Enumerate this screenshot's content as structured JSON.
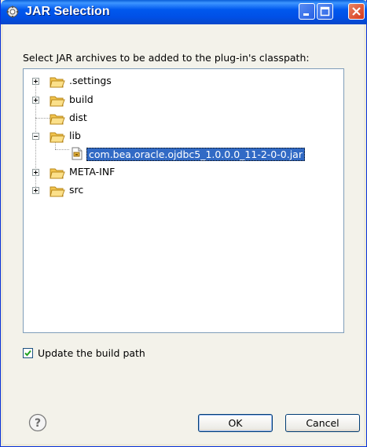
{
  "window": {
    "title": "JAR Selection",
    "icon": "gear-icon",
    "controls": [
      "minimize-icon",
      "maximize-icon",
      "close-icon"
    ]
  },
  "instructions": "Select JAR archives to be added to the plug-in's classpath:",
  "tree": {
    "nodes": [
      {
        "label": ".settings",
        "expandable": true,
        "expanded": false
      },
      {
        "label": "build",
        "expandable": true,
        "expanded": false
      },
      {
        "label": "dist",
        "expandable": false
      },
      {
        "label": "lib",
        "expandable": true,
        "expanded": true,
        "children": [
          {
            "label": "com.bea.oracle.ojdbc5_1.0.0.0_11-2-0-0.jar",
            "selected": true
          }
        ]
      },
      {
        "label": "META-INF",
        "expandable": true,
        "expanded": false
      },
      {
        "label": "src",
        "expandable": true,
        "expanded": false
      }
    ]
  },
  "update_build_path": {
    "label": "Update the build path",
    "checked": true
  },
  "buttons": {
    "ok": "OK",
    "cancel": "Cancel"
  },
  "colors": {
    "selection": "#316ac5",
    "titlebar": "#0054e3",
    "folder": "#f5c542"
  }
}
